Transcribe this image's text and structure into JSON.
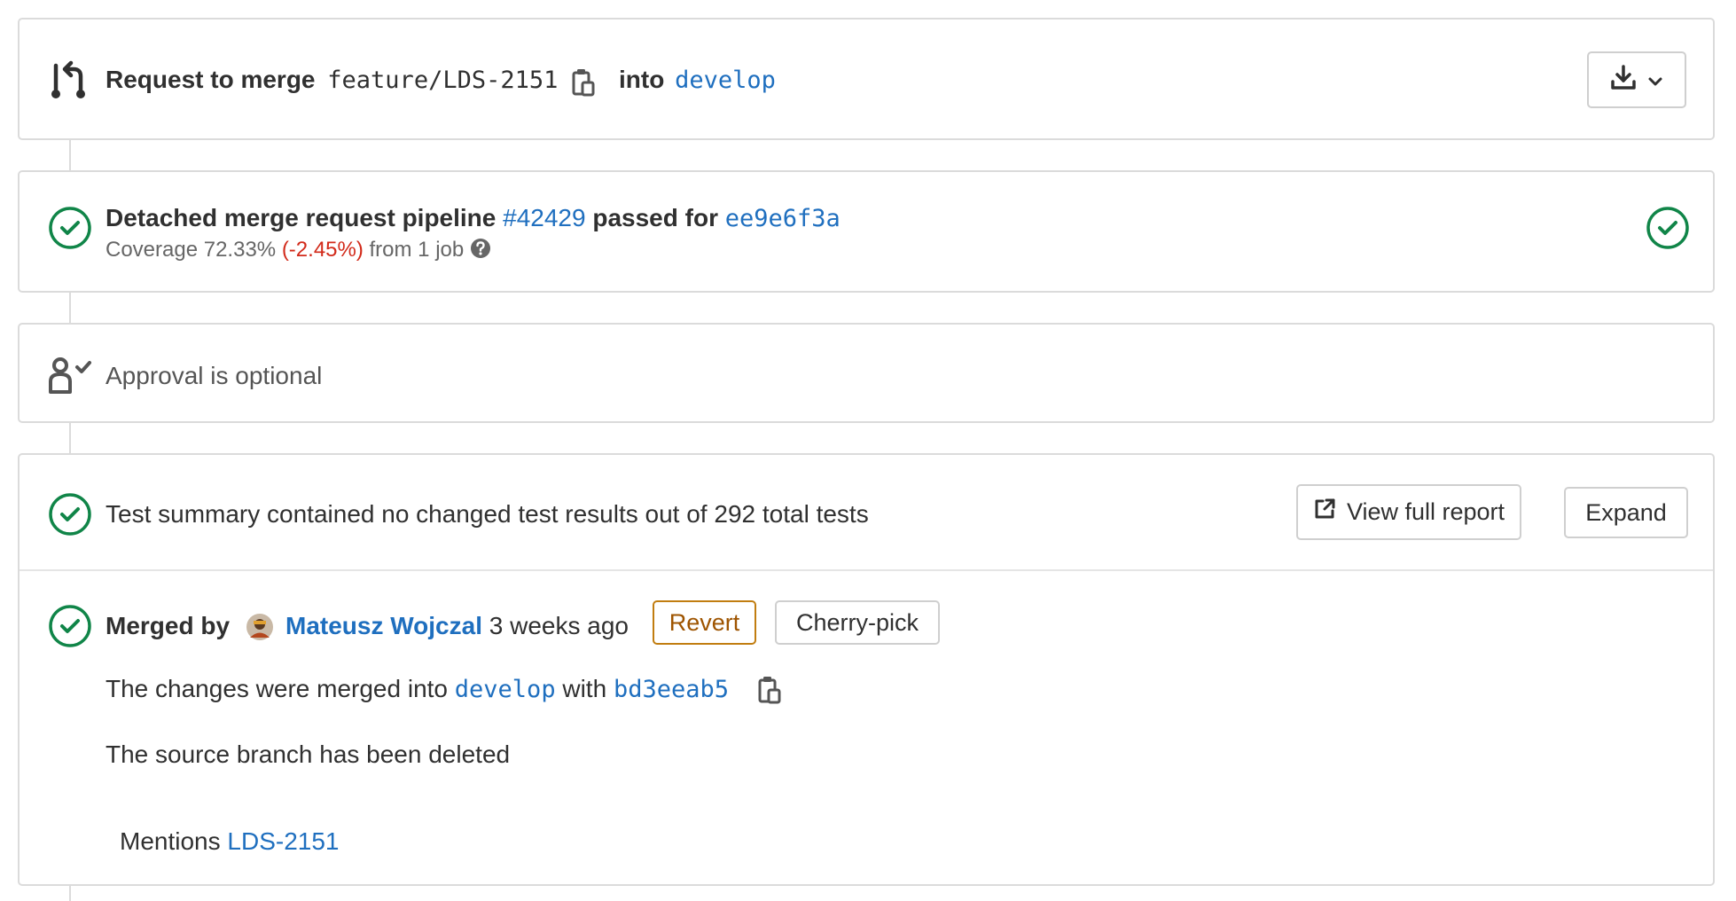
{
  "header": {
    "title_prefix": "Request to merge",
    "source_branch": "feature/LDS-2151",
    "into_label": "into",
    "target_branch": "develop",
    "copy_icon": "clipboard-icon",
    "merge_icon": "merge-request-icon",
    "download_icon": "download-icon",
    "dropdown_icon": "chevron-down-icon"
  },
  "pipeline": {
    "prefix": "Detached merge request pipeline",
    "pipeline_id": "#42429",
    "passed_for": "passed for",
    "commit": "ee9e6f3a",
    "coverage_label": "Coverage 72.33%",
    "coverage_change": "(-2.45%)",
    "coverage_suffix": "from 1 job",
    "status": "passed"
  },
  "approval": {
    "text": "Approval is optional"
  },
  "tests": {
    "summary": "Test summary contained no changed test results out of 292 total tests",
    "view_report_label": "View full report",
    "expand_label": "Expand"
  },
  "merged": {
    "merged_by_label": "Merged by",
    "user_name": "Mateusz Wojczal",
    "time_ago": "3 weeks ago",
    "revert_label": "Revert",
    "cherry_pick_label": "Cherry-pick",
    "changes_prefix": "The changes were merged into",
    "changes_branch": "develop",
    "changes_with": "with",
    "merge_commit": "bd3eeab5",
    "source_deleted": "The source branch has been deleted",
    "mentions_label": "Mentions",
    "mentions_issue": "LDS-2151"
  },
  "colors": {
    "success": "#108548",
    "link": "#1f6fbf",
    "danger": "#d22a1a",
    "warning": "#9e5400",
    "border": "#dbdbdb"
  }
}
